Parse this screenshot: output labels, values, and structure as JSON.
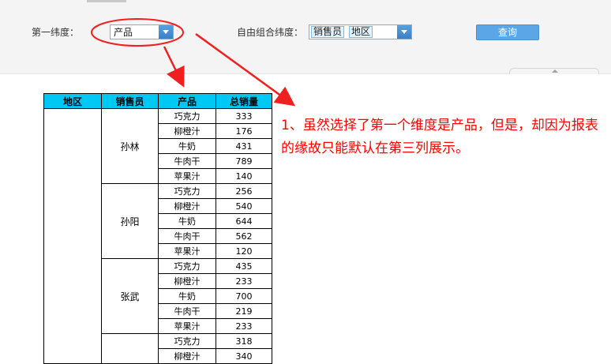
{
  "params": {
    "dim1_label": "第一纬度：",
    "dim1_value": "产品",
    "combo_label": "自由组合纬度：",
    "combo_tags": [
      "销售员",
      "地区"
    ],
    "query_label": "查询"
  },
  "table": {
    "headers": [
      "地区",
      "销售员",
      "产品",
      "总销量"
    ],
    "groups": [
      {
        "salesperson": "孙林",
        "rows": [
          [
            "巧克力",
            "333"
          ],
          [
            "柳橙汁",
            "176"
          ],
          [
            "牛奶",
            "431"
          ],
          [
            "牛肉干",
            "789"
          ],
          [
            "苹果汁",
            "140"
          ]
        ]
      },
      {
        "salesperson": "孙阳",
        "rows": [
          [
            "巧克力",
            "256"
          ],
          [
            "柳橙汁",
            "540"
          ],
          [
            "牛奶",
            "644"
          ],
          [
            "牛肉干",
            "562"
          ],
          [
            "苹果汁",
            "120"
          ]
        ]
      },
      {
        "salesperson": "张武",
        "rows": [
          [
            "巧克力",
            "435"
          ],
          [
            "柳橙汁",
            "233"
          ],
          [
            "牛奶",
            "700"
          ],
          [
            "牛肉干",
            "219"
          ],
          [
            "苹果汁",
            "233"
          ]
        ]
      },
      {
        "salesperson": "",
        "rows": [
          [
            "巧克力",
            "318"
          ],
          [
            "柳橙汁",
            "340"
          ]
        ]
      }
    ]
  },
  "annotation": {
    "text": "1、虽然选择了第一个维度是产品，但是，却因为报表的缘故只能默认在第三列展示。",
    "color": "#ff0000"
  }
}
